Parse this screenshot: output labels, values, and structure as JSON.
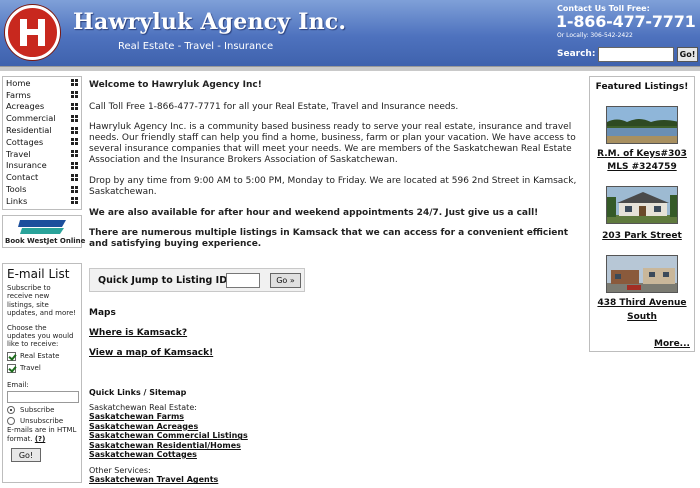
{
  "header": {
    "title": "Hawryluk Agency Inc.",
    "tagline": "Real Estate - Travel - Insurance",
    "contact_label": "Contact Us Toll Free:",
    "phone": "1-866-477-7771",
    "local": "Or Locally: 306-542-2422",
    "search_label": "Search:",
    "search_value": "",
    "search_button": "Go!",
    "brand_color": "#4e72be",
    "logo_color": "#c8281e"
  },
  "nav": {
    "items": [
      "Home",
      "Farms",
      "Acreages",
      "Commercial",
      "Residential",
      "Cottages",
      "Travel",
      "Insurance",
      "Contact",
      "Tools",
      "Links"
    ]
  },
  "westjet": {
    "logo_text": "WESTJET",
    "caption": "Book WestJet Online"
  },
  "email": {
    "title": "E-mail List",
    "intro": "Subscribe to receive new listings, site updates, and more!",
    "choose": "Choose the updates you would like to receive:",
    "option_real_estate": "Real Estate",
    "option_travel": "Travel",
    "email_label": "Email:",
    "email_value": "",
    "subscribe": "Subscribe",
    "unsubscribe": "Unsubscribe",
    "format_note": "E-mails are in HTML format.",
    "help": "(?)",
    "button": "Go!"
  },
  "main": {
    "welcome": "Welcome to Hawryluk Agency Inc!",
    "toll_free": "Call Toll Free 1-866-477-7771 for all your Real Estate, Travel and Insurance needs.",
    "about": "Hawryluk Agency Inc. is a community based business ready to serve your real estate, insurance and travel needs. Our friendly staff can help you find a home, business, farm or plan your vacation. We have access to several insurance companies that will meet your needs. We are members of the Saskatchewan Real Estate Association and the Insurance Brokers Association of Saskatchewan.",
    "hours": "Drop by any time from 9:00 AM to 5:00 PM, Monday to Friday. We are located at 596 2nd Street in Kamsack, Saskatchewan.",
    "after_hours": "We are also available for after hour and weekend appointments 24/7. Just give us a call!",
    "listings": "There are numerous multiple listings in Kamsack that we can access for a convenient efficient and satisfying buying experience.",
    "quick_jump_label": "Quick Jump to Listing ID:",
    "quick_jump_value": "",
    "quick_jump_button": "Go »",
    "maps_heading": "Maps",
    "map_link_1": "Where is Kamsack?",
    "map_link_2": "View a map of Kamsack!",
    "quicklinks_heading": "Quick Links / Sitemap",
    "re_heading": "Saskatchewan Real Estate:",
    "re_links": [
      "Saskatchewan Farms",
      "Saskatchewan Acreages",
      "Saskatchewan Commercial Listings",
      "Saskatchewan Residential/Homes",
      "Saskatchewan Cottages"
    ],
    "other_heading": "Other Services:",
    "other_links": [
      "Saskatchewan Travel Agents"
    ]
  },
  "featured": {
    "title": "Featured Listings!",
    "listings": [
      {
        "line1": "R.M. of Keys#303",
        "line2": "MLS #324759"
      },
      {
        "line1": "203 Park Street",
        "line2": ""
      },
      {
        "line1": "438 Third Avenue",
        "line2": "South"
      }
    ],
    "more": "More..."
  }
}
